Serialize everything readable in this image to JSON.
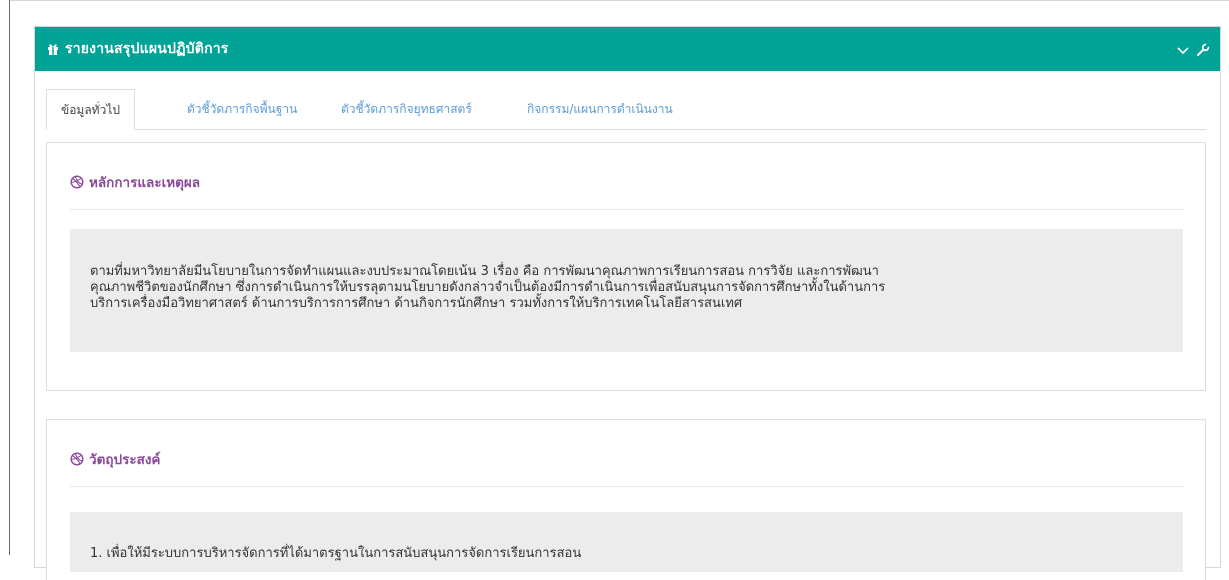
{
  "widget": {
    "title": "รายงานสรุปแผนปฏิบัติการ",
    "header_color": "#00a396",
    "title_icon": "gift-icon",
    "tools": [
      "chevron-down-icon",
      "wrench-icon"
    ]
  },
  "tabs": [
    {
      "label": "ข้อมูลทั่วไป",
      "active": true
    },
    {
      "label": "ตัวชี้วัดภารกิจพื้นฐาน",
      "active": false
    },
    {
      "label": "ตัวชี้วัดภารกิจยุทธศาสตร์",
      "active": false
    },
    {
      "label": "กิจกรรม/แผนการดำเนินงาน",
      "active": false
    }
  ],
  "sections": {
    "rationale": {
      "icon": "dribbble-icon",
      "heading": "หลักการและเหตุผล",
      "lines": [
        "ตามที่มหาวิทยาลัยมีนโยบายในการจัดทำแผนและงบประมาณโดยเน้น 3 เรื่อง คือ การพัฒนาคุณภาพการเรียนการสอน การวิจัย และการพัฒนา",
        "คุณภาพชีวิตของนักศึกษา ซึ่งการดำเนินการให้บรรลุตามนโยบายดังกล่าวจำเป็นต้องมีการดำเนินการเพื่อสนับสนุนการจัดการศึกษาทั้งในด้านการ",
        "บริการเครื่องมือวิทยาศาสตร์ ด้านการบริการการศึกษา ด้านกิจการนักศึกษา รวมทั้งการให้บริการเทคโนโลยีสารสนเทศ"
      ]
    },
    "objectives": {
      "icon": "dribbble-icon",
      "heading": "วัตถุประสงค์",
      "items": [
        "1. เพื่อให้มีระบบการบริหารจัดการที่ได้มาตรฐานในการสนับสนุนการจัดการเรียนการสอน"
      ]
    }
  },
  "colors": {
    "accent_teal": "#00a396",
    "heading_purple": "#8a4a9a",
    "tab_link_blue": "#5b9bd5",
    "panel_body_bg": "#ececec"
  }
}
